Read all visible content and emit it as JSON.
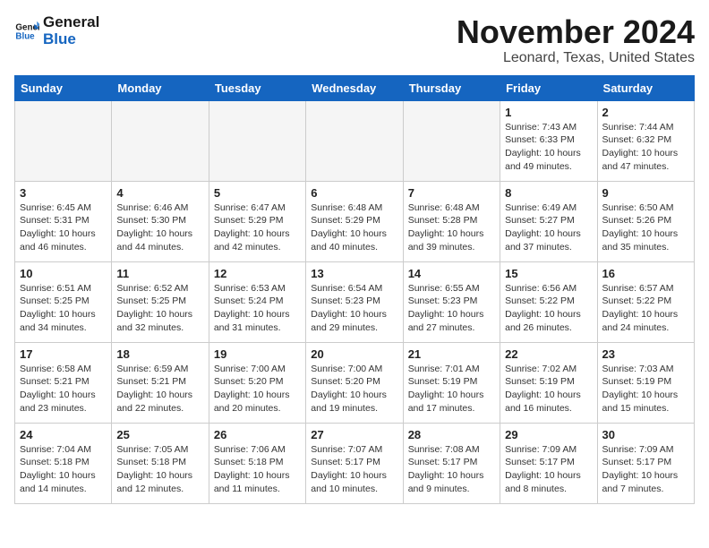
{
  "header": {
    "logo_line1": "General",
    "logo_line2": "Blue",
    "title": "November 2024",
    "subtitle": "Leonard, Texas, United States"
  },
  "weekdays": [
    "Sunday",
    "Monday",
    "Tuesday",
    "Wednesday",
    "Thursday",
    "Friday",
    "Saturday"
  ],
  "weeks": [
    [
      {
        "day": "",
        "detail": ""
      },
      {
        "day": "",
        "detail": ""
      },
      {
        "day": "",
        "detail": ""
      },
      {
        "day": "",
        "detail": ""
      },
      {
        "day": "",
        "detail": ""
      },
      {
        "day": "1",
        "detail": "Sunrise: 7:43 AM\nSunset: 6:33 PM\nDaylight: 10 hours\nand 49 minutes."
      },
      {
        "day": "2",
        "detail": "Sunrise: 7:44 AM\nSunset: 6:32 PM\nDaylight: 10 hours\nand 47 minutes."
      }
    ],
    [
      {
        "day": "3",
        "detail": "Sunrise: 6:45 AM\nSunset: 5:31 PM\nDaylight: 10 hours\nand 46 minutes."
      },
      {
        "day": "4",
        "detail": "Sunrise: 6:46 AM\nSunset: 5:30 PM\nDaylight: 10 hours\nand 44 minutes."
      },
      {
        "day": "5",
        "detail": "Sunrise: 6:47 AM\nSunset: 5:29 PM\nDaylight: 10 hours\nand 42 minutes."
      },
      {
        "day": "6",
        "detail": "Sunrise: 6:48 AM\nSunset: 5:29 PM\nDaylight: 10 hours\nand 40 minutes."
      },
      {
        "day": "7",
        "detail": "Sunrise: 6:48 AM\nSunset: 5:28 PM\nDaylight: 10 hours\nand 39 minutes."
      },
      {
        "day": "8",
        "detail": "Sunrise: 6:49 AM\nSunset: 5:27 PM\nDaylight: 10 hours\nand 37 minutes."
      },
      {
        "day": "9",
        "detail": "Sunrise: 6:50 AM\nSunset: 5:26 PM\nDaylight: 10 hours\nand 35 minutes."
      }
    ],
    [
      {
        "day": "10",
        "detail": "Sunrise: 6:51 AM\nSunset: 5:25 PM\nDaylight: 10 hours\nand 34 minutes."
      },
      {
        "day": "11",
        "detail": "Sunrise: 6:52 AM\nSunset: 5:25 PM\nDaylight: 10 hours\nand 32 minutes."
      },
      {
        "day": "12",
        "detail": "Sunrise: 6:53 AM\nSunset: 5:24 PM\nDaylight: 10 hours\nand 31 minutes."
      },
      {
        "day": "13",
        "detail": "Sunrise: 6:54 AM\nSunset: 5:23 PM\nDaylight: 10 hours\nand 29 minutes."
      },
      {
        "day": "14",
        "detail": "Sunrise: 6:55 AM\nSunset: 5:23 PM\nDaylight: 10 hours\nand 27 minutes."
      },
      {
        "day": "15",
        "detail": "Sunrise: 6:56 AM\nSunset: 5:22 PM\nDaylight: 10 hours\nand 26 minutes."
      },
      {
        "day": "16",
        "detail": "Sunrise: 6:57 AM\nSunset: 5:22 PM\nDaylight: 10 hours\nand 24 minutes."
      }
    ],
    [
      {
        "day": "17",
        "detail": "Sunrise: 6:58 AM\nSunset: 5:21 PM\nDaylight: 10 hours\nand 23 minutes."
      },
      {
        "day": "18",
        "detail": "Sunrise: 6:59 AM\nSunset: 5:21 PM\nDaylight: 10 hours\nand 22 minutes."
      },
      {
        "day": "19",
        "detail": "Sunrise: 7:00 AM\nSunset: 5:20 PM\nDaylight: 10 hours\nand 20 minutes."
      },
      {
        "day": "20",
        "detail": "Sunrise: 7:00 AM\nSunset: 5:20 PM\nDaylight: 10 hours\nand 19 minutes."
      },
      {
        "day": "21",
        "detail": "Sunrise: 7:01 AM\nSunset: 5:19 PM\nDaylight: 10 hours\nand 17 minutes."
      },
      {
        "day": "22",
        "detail": "Sunrise: 7:02 AM\nSunset: 5:19 PM\nDaylight: 10 hours\nand 16 minutes."
      },
      {
        "day": "23",
        "detail": "Sunrise: 7:03 AM\nSunset: 5:19 PM\nDaylight: 10 hours\nand 15 minutes."
      }
    ],
    [
      {
        "day": "24",
        "detail": "Sunrise: 7:04 AM\nSunset: 5:18 PM\nDaylight: 10 hours\nand 14 minutes."
      },
      {
        "day": "25",
        "detail": "Sunrise: 7:05 AM\nSunset: 5:18 PM\nDaylight: 10 hours\nand 12 minutes."
      },
      {
        "day": "26",
        "detail": "Sunrise: 7:06 AM\nSunset: 5:18 PM\nDaylight: 10 hours\nand 11 minutes."
      },
      {
        "day": "27",
        "detail": "Sunrise: 7:07 AM\nSunset: 5:17 PM\nDaylight: 10 hours\nand 10 minutes."
      },
      {
        "day": "28",
        "detail": "Sunrise: 7:08 AM\nSunset: 5:17 PM\nDaylight: 10 hours\nand 9 minutes."
      },
      {
        "day": "29",
        "detail": "Sunrise: 7:09 AM\nSunset: 5:17 PM\nDaylight: 10 hours\nand 8 minutes."
      },
      {
        "day": "30",
        "detail": "Sunrise: 7:09 AM\nSunset: 5:17 PM\nDaylight: 10 hours\nand 7 minutes."
      }
    ]
  ]
}
